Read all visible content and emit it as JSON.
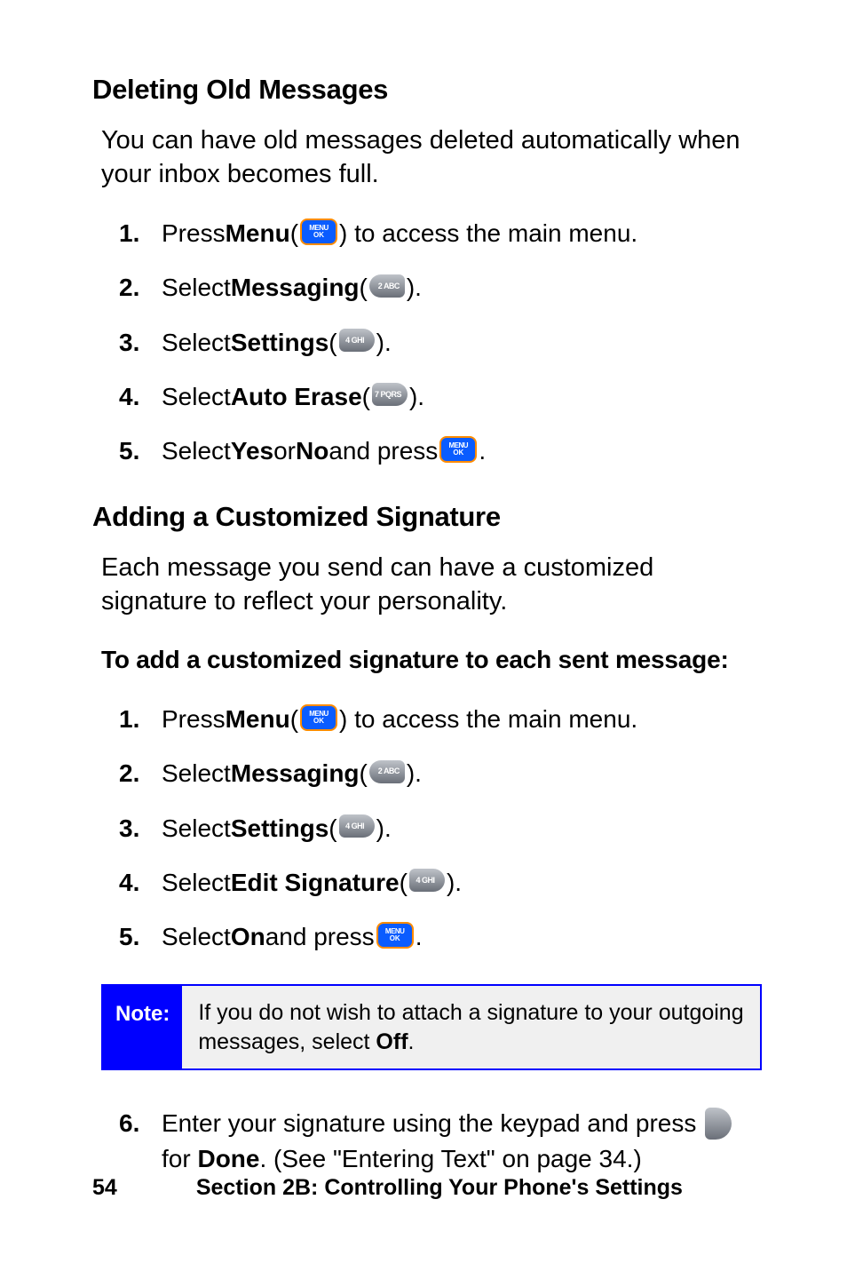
{
  "icons": {
    "menu_l1": "MENU",
    "menu_l2": "OK",
    "k2": "2 ABC",
    "k4": "4 GHI",
    "k7": "7 PQRS",
    "dots": "···"
  },
  "sec1": {
    "title": "Deleting Old Messages",
    "intro": "You can have old messages deleted automatically when your inbox becomes full.",
    "s1_n": "1.",
    "s1_a": "Press ",
    "s1_b": "Menu",
    "s1_c": " (",
    "s1_d": ") to access the main menu.",
    "s2_n": "2.",
    "s2_a": "Select ",
    "s2_b": "Messaging",
    "s2_c": " (",
    "s2_d": ").",
    "s3_n": "3.",
    "s3_a": "Select ",
    "s3_b": "Settings",
    "s3_c": " (",
    "s3_d": ").",
    "s4_n": "4.",
    "s4_a": "Select ",
    "s4_b": "Auto Erase",
    "s4_c": " (",
    "s4_d": ").",
    "s5_n": "5.",
    "s5_a": "Select ",
    "s5_b": "Yes",
    "s5_c": " or ",
    "s5_d": "No",
    "s5_e": " and press ",
    "s5_f": "."
  },
  "sec2": {
    "title": "Adding a Customized Signature",
    "intro": "Each message you send can have a customized signature to reflect your personality.",
    "subhead": "To add a customized signature to each sent message:",
    "s1_n": "1.",
    "s1_a": "Press ",
    "s1_b": "Menu",
    "s1_c": " (",
    "s1_d": ") to access the main menu.",
    "s2_n": "2.",
    "s2_a": "Select ",
    "s2_b": "Messaging",
    "s2_c": " (",
    "s2_d": ").",
    "s3_n": "3.",
    "s3_a": "Select ",
    "s3_b": "Settings",
    "s3_c": " (",
    "s3_d": ").",
    "s4_n": "4.",
    "s4_a": "Select ",
    "s4_b": "Edit Signature",
    "s4_c": " (",
    "s4_d": ").",
    "s5_n": "5.",
    "s5_a": "Select ",
    "s5_b": "On",
    "s5_c": " and press ",
    "s5_d": "."
  },
  "note": {
    "label": "Note:",
    "text_a": "If you do not wish to attach a signature to your outgoing messages, select ",
    "text_b": "Off",
    "text_c": "."
  },
  "sec3": {
    "s6_n": "6.",
    "s6_a": "Enter your signature using the keypad and press ",
    "s6_b": " for ",
    "s6_c": "Done",
    "s6_d": ". (See \"Entering Text\" on page 34.)"
  },
  "footer": {
    "page": "54",
    "text": "Section 2B: Controlling Your Phone's Settings"
  }
}
